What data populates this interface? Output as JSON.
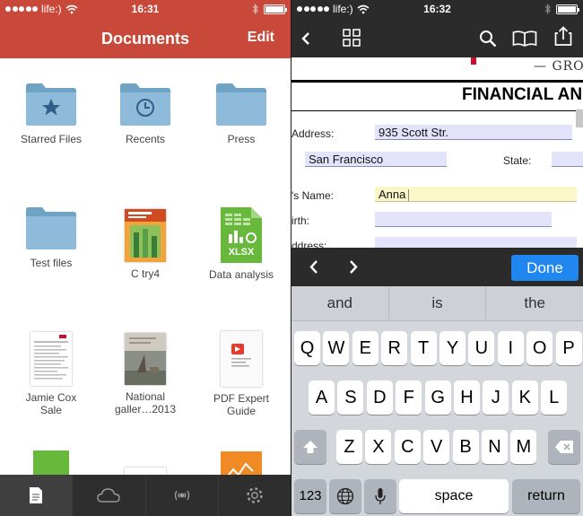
{
  "left": {
    "status": {
      "carrier": "life:)",
      "time": "16:31"
    },
    "header": {
      "title": "Documents",
      "edit_label": "Edit",
      "color": "#c8483a"
    },
    "items": [
      {
        "label": "Starred Files",
        "icon": "star-folder-icon"
      },
      {
        "label": "Recents",
        "icon": "clock-folder-icon"
      },
      {
        "label": "Press",
        "icon": "folder-icon"
      },
      {
        "label": "Test files",
        "icon": "folder-icon"
      },
      {
        "label": "C try4",
        "icon": "book-cover-thumbnail"
      },
      {
        "label": "Data analysis",
        "icon": "xlsx-file-icon",
        "badge": "XLSX"
      },
      {
        "label": "Jamie Cox Sale",
        "icon": "form-document-thumbnail"
      },
      {
        "label": "National galler…2013",
        "icon": "painting-document-thumbnail"
      },
      {
        "label": "PDF Expert Guide",
        "icon": "guide-document-thumbnail"
      }
    ],
    "tabbar": [
      "documents-tab-icon",
      "cloud-tab-icon",
      "wifi-transfer-tab-icon",
      "settings-tab-icon"
    ]
  },
  "right": {
    "status": {
      "carrier": "life:)",
      "time": "16:32"
    },
    "document": {
      "logo_text": "— GROU",
      "heading": "FINANCIAL AN",
      "address_label": "Address:",
      "address_value": "935 Scott Str.",
      "city_value": "San Francisco",
      "state_label": "State:",
      "name_label": "'s Name:",
      "name_value": "Anna",
      "birth_label": "irth:",
      "address2_label": "ddress:"
    },
    "accessory": {
      "done_label": "Done",
      "done_color": "#1f87ef"
    },
    "suggestions": [
      "and",
      "is",
      "the"
    ],
    "keyboard": {
      "row1": [
        "Q",
        "W",
        "E",
        "R",
        "T",
        "Y",
        "U",
        "I",
        "O",
        "P"
      ],
      "row2": [
        "A",
        "S",
        "D",
        "F",
        "G",
        "H",
        "J",
        "K",
        "L"
      ],
      "row3": [
        "Z",
        "X",
        "C",
        "V",
        "B",
        "N",
        "M"
      ],
      "numbers_label": "123",
      "space_label": "space",
      "return_label": "return"
    }
  }
}
